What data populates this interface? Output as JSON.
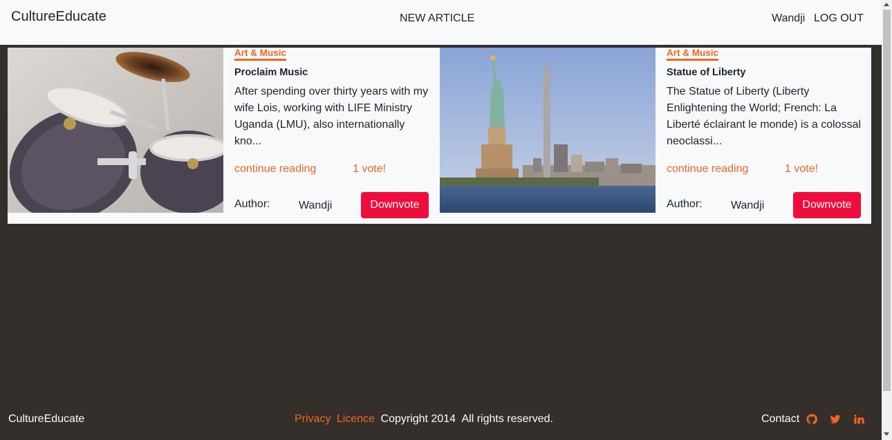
{
  "navbar": {
    "brand": "CultureEducate",
    "new_article": "NEW ARTICLE",
    "user": "Wandji",
    "logout": "LOG OUT"
  },
  "articles": [
    {
      "category": "Art & Music",
      "title": "Proclaim Music",
      "excerpt": "After spending over thirty years with my wife Lois, working with LIFE Ministry Uganda (LMU), also internationally kno...",
      "continue": "continue reading",
      "votes": "1 vote!",
      "author_label": "Author:",
      "author": "Wandji",
      "downvote": "Downvote",
      "image": "drum-kit-photo"
    },
    {
      "category": "Art & Music",
      "title": "Statue of Liberty",
      "excerpt": "The Statue of Liberty (Liberty Enlightening the World; French: La Liberté éclairant le monde) is a colossal neoclassi...",
      "continue": "continue reading",
      "votes": "1 vote!",
      "author_label": "Author:",
      "author": "Wandji",
      "downvote": "Downvote",
      "image": "statue-of-liberty-photo"
    }
  ],
  "footer": {
    "brand": "CultureEducate",
    "privacy": "Privacy",
    "licence": "Licence",
    "copyright": "Copyright 2014",
    "rights": "All rights reserved.",
    "contact": "Contact",
    "icons": [
      "github-icon",
      "twitter-icon",
      "linkedin-icon"
    ]
  },
  "colors": {
    "accent": "#f26522",
    "downvote": "#ef0d3e",
    "background": "#352f2c",
    "surface": "#f8f9fa"
  }
}
